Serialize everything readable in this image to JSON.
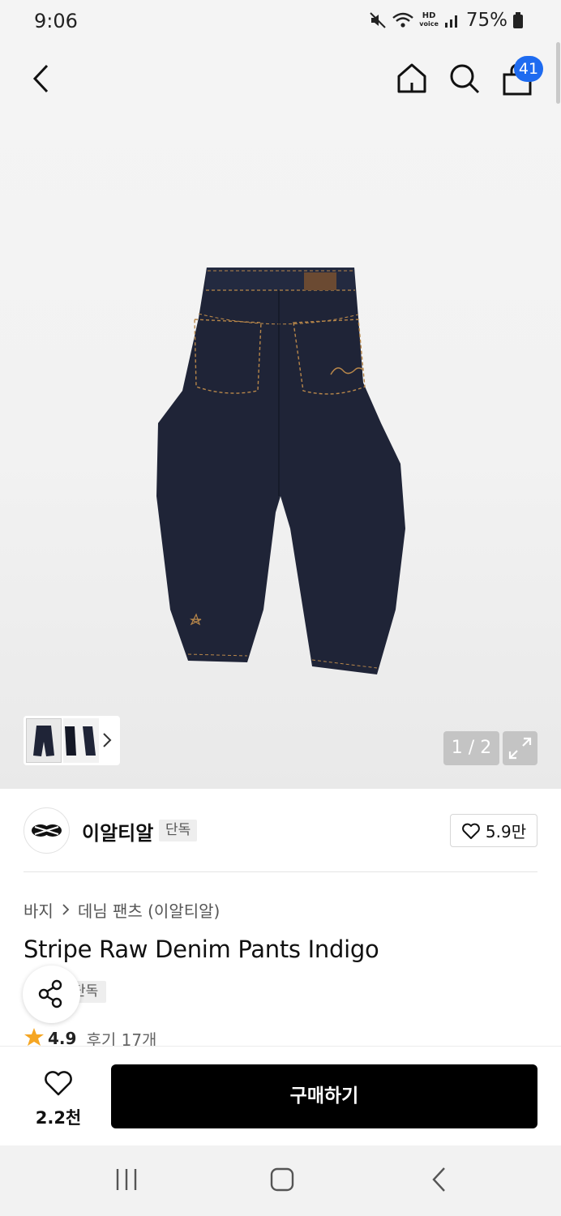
{
  "status_bar": {
    "time": "9:06",
    "battery": "75%",
    "icons": [
      "mute-icon",
      "wifi-icon",
      "hd-voice-icon",
      "signal-icon",
      "battery-icon"
    ],
    "hd_label": "HD",
    "voice_label": "voice"
  },
  "header": {
    "icons": [
      "back-icon",
      "home-icon",
      "search-icon",
      "cart-icon"
    ],
    "cart_count": "41"
  },
  "gallery": {
    "page_indicator": "1 / 2",
    "thumbnails": [
      "pants-back-thumbnail",
      "pants-side-thumbnail"
    ],
    "icons": [
      "chevron-right-icon",
      "expand-icon"
    ]
  },
  "brand": {
    "name": "이알티알",
    "tag": "단독",
    "likes": "5.9만",
    "logo_icon": "brand-logo-icon"
  },
  "product": {
    "breadcrumb": [
      "바지",
      "데님 팬츠 (이알티알)"
    ],
    "title": "Stripe Raw Denim Pants Indigo",
    "exclusive_tag": "단독",
    "rating": "4.9",
    "reviews": "후기 17개"
  },
  "bottom_bar": {
    "wish_count": "2.2천",
    "buy_label": "구매하기"
  },
  "navigation": {
    "icons": [
      "recent-apps-icon",
      "home-button-icon",
      "back-button-icon"
    ]
  },
  "colors": {
    "accent": "#1e6bf0",
    "buy_button": "#000000",
    "star": "#f5a623",
    "denim": "#1f2437",
    "stitch": "#b8874a"
  }
}
